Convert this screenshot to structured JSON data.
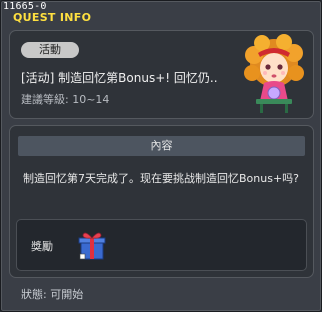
{
  "header": {
    "quest_id": "11665-0",
    "title": "QUEST INFO"
  },
  "quest": {
    "type_label": "活動",
    "title": "[活动] 制造回忆第Bonus+! 回忆仍..",
    "level_range": "建議等級: 10~14"
  },
  "content": {
    "header": "內容",
    "text": "制造回忆第7天完成了。现在要挑战制造回忆Bonus+吗?"
  },
  "reward": {
    "label": "獎勵",
    "item_icon": "gift-box-icon"
  },
  "status": {
    "text": "狀態: 可開始"
  },
  "colors": {
    "title_yellow": "#ffe040",
    "panel_bg": "#2f3339",
    "window_bg": "#3a3e46"
  }
}
